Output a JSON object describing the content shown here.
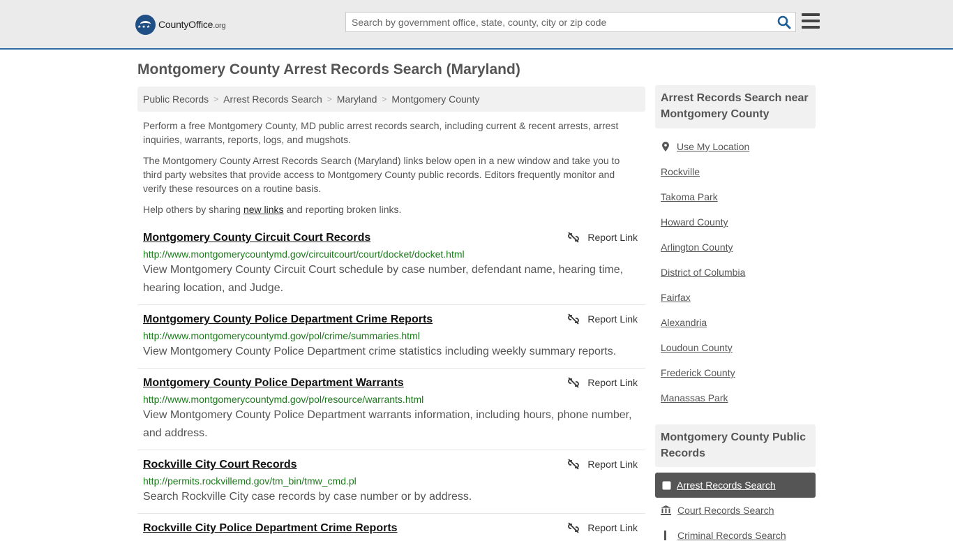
{
  "header": {
    "logo_name": "CountyOffice",
    "logo_tld": ".org",
    "search_placeholder": "Search by government office, state, county, city or zip code"
  },
  "page_title": "Montgomery County Arrest Records Search (Maryland)",
  "breadcrumb": [
    "Public Records",
    "Arrest Records Search",
    "Maryland",
    "Montgomery County"
  ],
  "intro": {
    "p1": "Perform a free Montgomery County, MD public arrest records search, including current & recent arrests, arrest inquiries, warrants, reports, logs, and mugshots.",
    "p2": "The Montgomery County Arrest Records Search (Maryland) links below open in a new window and take you to third party websites that provide access to Montgomery County public records. Editors frequently monitor and verify these resources on a routine basis.",
    "p3_before": "Help others by sharing ",
    "p3_link": "new links",
    "p3_after": " and reporting broken links."
  },
  "report_label": "Report Link",
  "links": [
    {
      "title": "Montgomery County Circuit Court Records",
      "url": "http://www.montgomerycountymd.gov/circuitcourt/court/docket/docket.html",
      "desc": "View Montgomery County Circuit Court schedule by case number, defendant name, hearing time, hearing location, and Judge."
    },
    {
      "title": "Montgomery County Police Department Crime Reports",
      "url": "http://www.montgomerycountymd.gov/pol/crime/summaries.html",
      "desc": "View Montgomery County Police Department crime statistics including weekly summary reports."
    },
    {
      "title": "Montgomery County Police Department Warrants",
      "url": "http://www.montgomerycountymd.gov/pol/resource/warrants.html",
      "desc": "View Montgomery County Police Department warrants information, including hours, phone number, and address."
    },
    {
      "title": "Rockville City Court Records",
      "url": "http://permits.rockvillemd.gov/tm_bin/tmw_cmd.pl",
      "desc": "Search Rockville City case records by case number or by address."
    },
    {
      "title": "Rockville City Police Department Crime Reports",
      "url": "",
      "desc": ""
    }
  ],
  "sidebar": {
    "nearby_heading": "Arrest Records Search near Montgomery County",
    "use_location": "Use My Location",
    "nearby": [
      "Rockville",
      "Takoma Park",
      "Howard County",
      "Arlington County",
      "District of Columbia",
      "Fairfax",
      "Alexandria",
      "Loudoun County",
      "Frederick County",
      "Manassas Park"
    ],
    "records_heading": "Montgomery County Public Records",
    "records": [
      {
        "label": "Arrest Records Search",
        "icon": "checkbox-icon",
        "active": true
      },
      {
        "label": "Court Records Search",
        "icon": "courthouse-icon",
        "active": false
      },
      {
        "label": "Criminal Records Search",
        "icon": "gavel-icon",
        "active": false
      }
    ]
  }
}
